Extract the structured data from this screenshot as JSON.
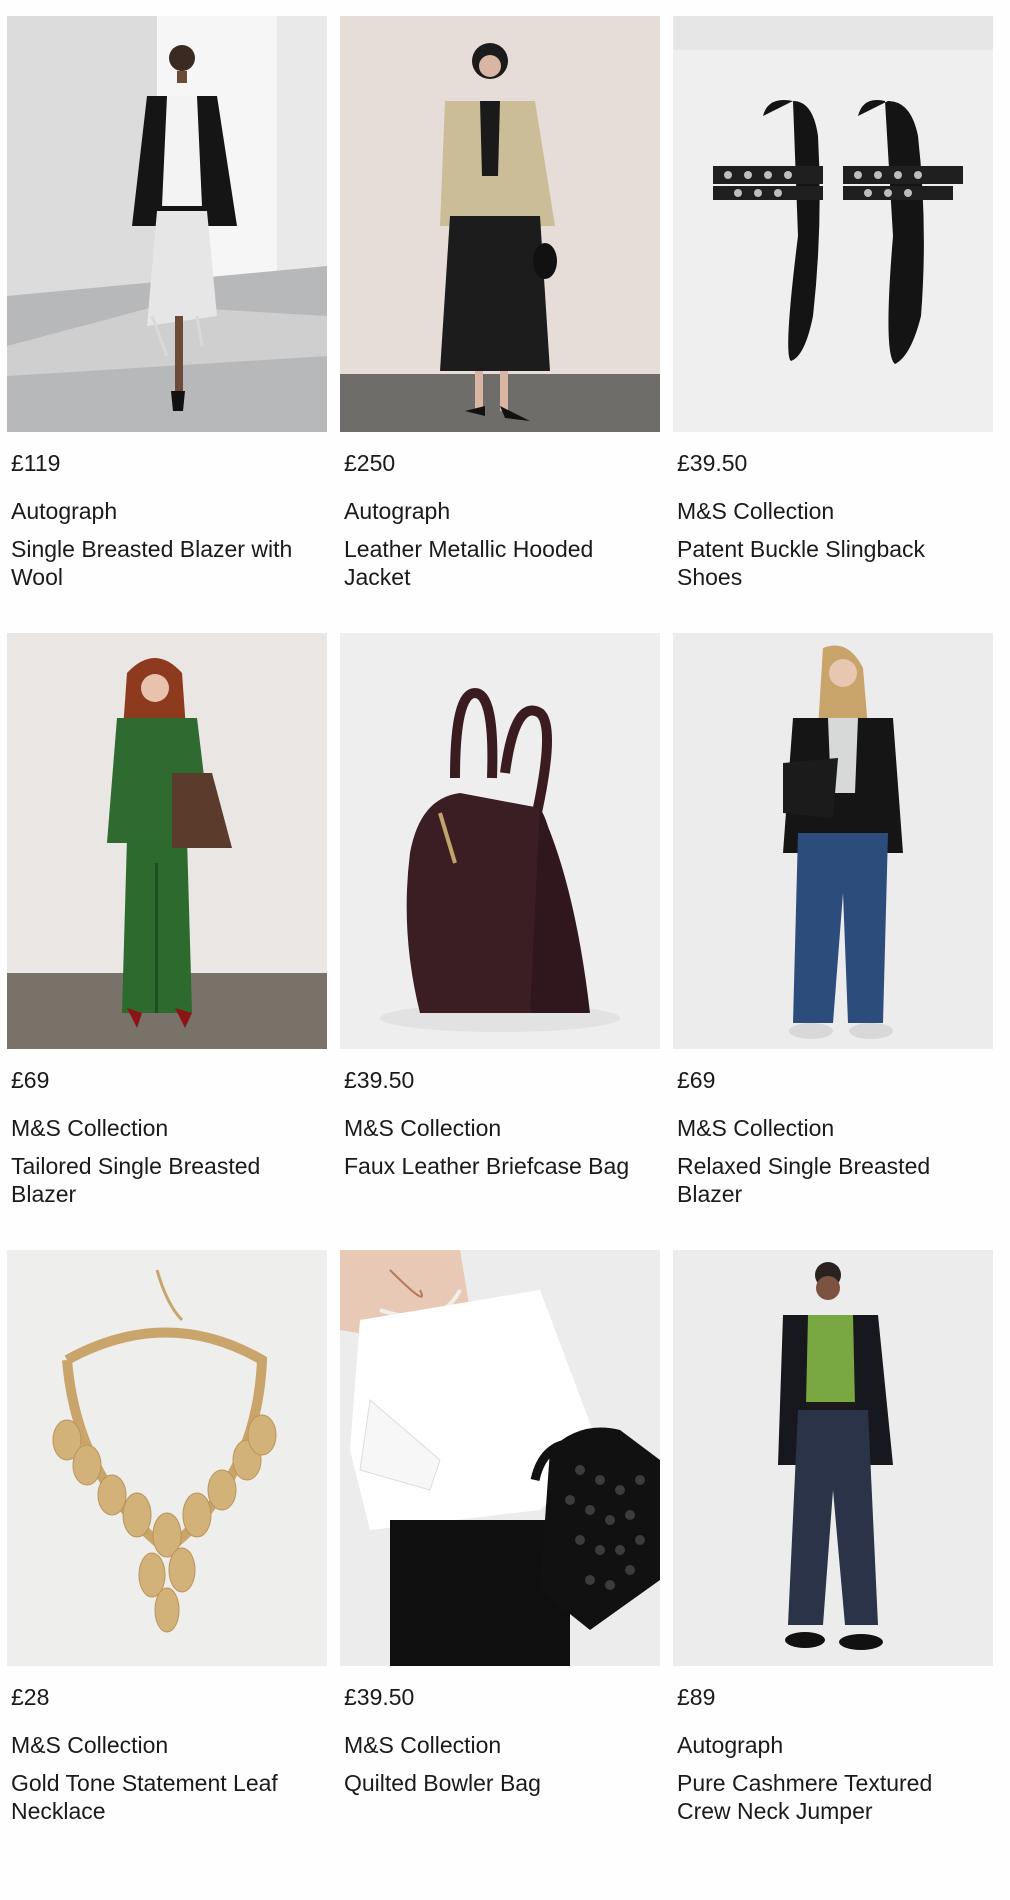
{
  "products": [
    {
      "price": "£119",
      "brand": "Autograph",
      "title": "Single Breasted Blazer with Wool",
      "image_icon": "woman-black-blazer-fringe-skirt-photo"
    },
    {
      "price": "£250",
      "brand": "Autograph",
      "title": "Leather Metallic Hooded Jacket",
      "image_icon": "woman-metallic-jacket-photo"
    },
    {
      "price": "£39.50",
      "brand": "M&S Collection",
      "title": "Patent Buckle Slingback Shoes",
      "image_icon": "black-slingback-shoes-photo"
    },
    {
      "price": "£69",
      "brand": "M&S Collection",
      "title": "Tailored Single Breasted Blazer",
      "image_icon": "woman-green-suit-photo"
    },
    {
      "price": "£39.50",
      "brand": "M&S Collection",
      "title": "Faux Leather Briefcase Bag",
      "image_icon": "burgundy-briefcase-bag-photo"
    },
    {
      "price": "£69",
      "brand": "M&S Collection",
      "title": "Relaxed Single Breasted Blazer",
      "image_icon": "woman-black-blazer-jeans-photo"
    },
    {
      "price": "£28",
      "brand": "M&S Collection",
      "title": "Gold Tone Statement Leaf Necklace",
      "image_icon": "gold-leaf-necklace-photo"
    },
    {
      "price": "£39.50",
      "brand": "M&S Collection",
      "title": "Quilted Bowler Bag",
      "image_icon": "quilted-bowler-bag-photo"
    },
    {
      "price": "£89",
      "brand": "Autograph",
      "title": "Pure Cashmere Textured Crew Neck Jumper",
      "image_icon": "woman-green-jumper-photo"
    }
  ]
}
